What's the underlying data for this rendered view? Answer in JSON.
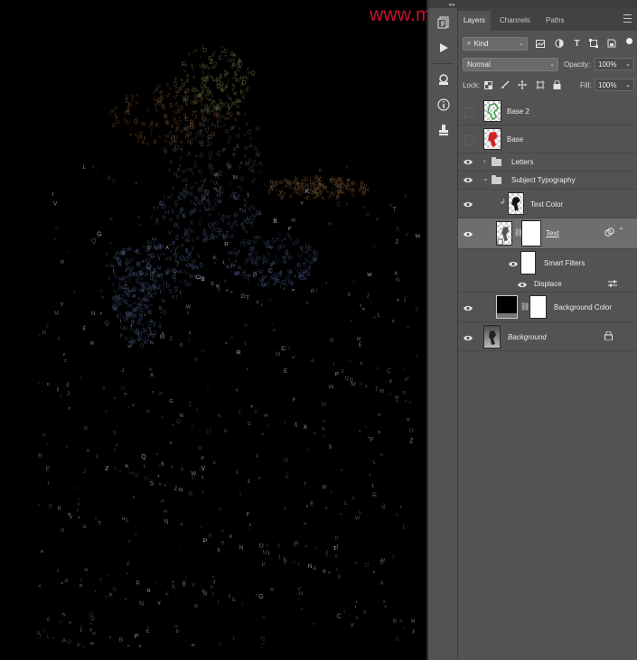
{
  "watermark": "www.missyuan.net",
  "tabs": [
    {
      "label": "Layers",
      "active": true
    },
    {
      "label": "Channels",
      "active": false
    },
    {
      "label": "Paths",
      "active": false
    }
  ],
  "filter": {
    "kind_label": "Kind"
  },
  "blend": {
    "mode": "Normal",
    "opacity_label": "Opacity:",
    "opacity_value": "100%"
  },
  "lock": {
    "label": "Lock:",
    "fill_label": "Fill:",
    "fill_value": "100%"
  },
  "layers": [
    {
      "name": "Base 2",
      "visible": false
    },
    {
      "name": "Base",
      "visible": false
    },
    {
      "name": "Letters",
      "visible": true,
      "type": "group",
      "expanded": false
    },
    {
      "name": "Subject Typography",
      "visible": true,
      "type": "group",
      "expanded": true
    },
    {
      "name": "Text Color",
      "visible": true,
      "clipped": true
    },
    {
      "name": "Text",
      "visible": true,
      "selected": true,
      "smart_object": true
    },
    {
      "name": "Smart Filters",
      "visible": true
    },
    {
      "name": "Displace",
      "visible": true
    },
    {
      "name": "Background Color",
      "visible": true
    },
    {
      "name": "Background",
      "visible": true,
      "locked": true
    }
  ],
  "colors": {
    "accent_red": "#c8102e",
    "panel_bg": "#535353",
    "selected_row": "#6e6e6e"
  }
}
